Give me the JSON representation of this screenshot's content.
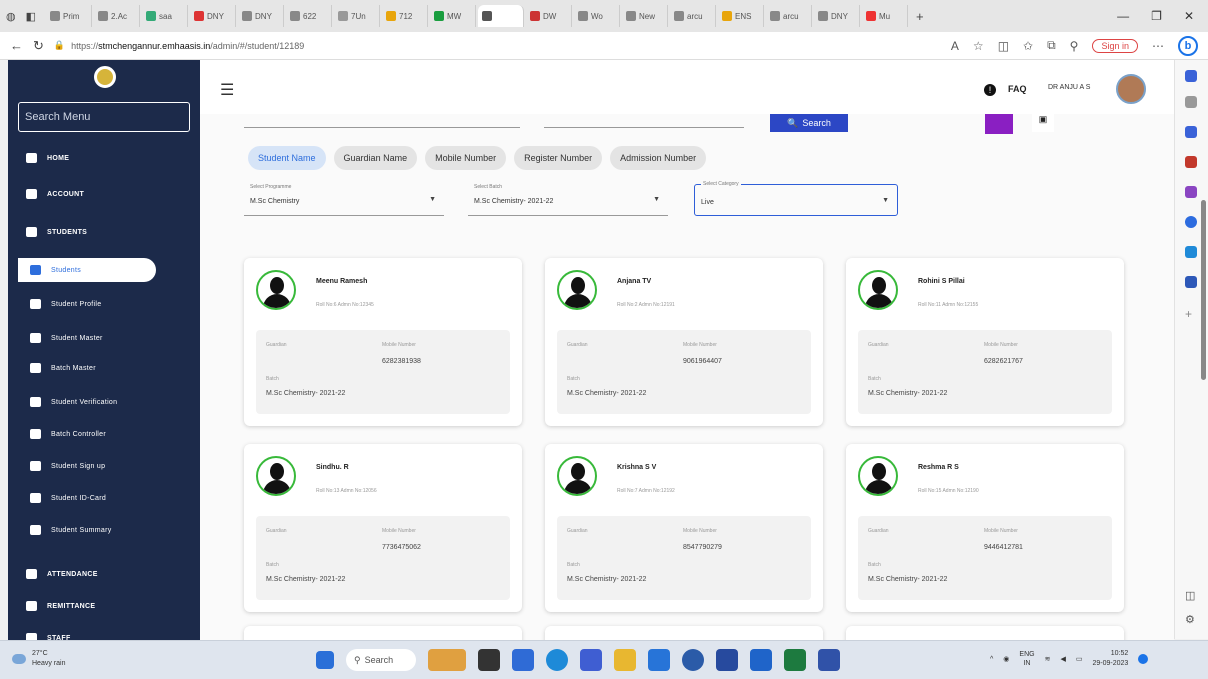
{
  "browser": {
    "tabs": [
      "Prim",
      "2.Ac",
      "saa",
      "DNY",
      "DNY",
      "622",
      "7Un",
      "712",
      "MW",
      "",
      "DW",
      "Wo",
      "New",
      "arcu",
      "ENS",
      "arcu",
      "DNY",
      "Mu"
    ],
    "tab_colors": [
      "#888",
      "#888",
      "#3a7",
      "#d33",
      "#888",
      "#888",
      "#999",
      "#e8a50c",
      "#1a9e3f",
      "#555",
      "#c33",
      "#888",
      "#888",
      "#888",
      "#e8a50c",
      "#888",
      "#888",
      "#e33"
    ],
    "url_prefix": "https://",
    "url_host": "stmchengannur.emhaasis.in",
    "url_path": "/admin/#/student/12189",
    "signin_label": "Sign in",
    "bing_label": "b"
  },
  "sidebar": {
    "search_placeholder": "Search Menu",
    "items": [
      {
        "label": "HOME",
        "icon": "home-icon",
        "name": "sidebar-item-home"
      },
      {
        "label": "ACCOUNT",
        "icon": "account-icon",
        "name": "sidebar-item-account"
      },
      {
        "label": "STUDENTS",
        "icon": "students-icon",
        "name": "sidebar-item-students"
      },
      {
        "label": "Students",
        "icon": "students-group-icon",
        "name": "sidebar-item-students-list"
      },
      {
        "label": "Student Profile",
        "icon": "profile-icon",
        "name": "sidebar-item-student-profile"
      },
      {
        "label": "Student Master",
        "icon": "gear-icon",
        "name": "sidebar-item-student-master"
      },
      {
        "label": "Batch Master",
        "icon": "gear-icon",
        "name": "sidebar-item-batch-master"
      },
      {
        "label": "Student Verification",
        "icon": "verification-icon",
        "name": "sidebar-item-student-verification"
      },
      {
        "label": "Batch Controller",
        "icon": "gear-icon",
        "name": "sidebar-item-batch-controller"
      },
      {
        "label": "Student Sign up",
        "icon": "signup-icon",
        "name": "sidebar-item-student-signup"
      },
      {
        "label": "Student ID-Card",
        "icon": "id-card-icon",
        "name": "sidebar-item-student-id-card"
      },
      {
        "label": "Student Summary",
        "icon": "summary-icon",
        "name": "sidebar-item-student-summary"
      },
      {
        "label": "ATTENDANCE",
        "icon": "attendance-icon",
        "name": "sidebar-item-attendance"
      },
      {
        "label": "REMITTANCE",
        "icon": "remittance-icon",
        "name": "sidebar-item-remittance"
      },
      {
        "label": "STAFF",
        "icon": "staff-icon",
        "name": "sidebar-item-staff"
      }
    ]
  },
  "header": {
    "menu_icon": "☰",
    "help_icon": "!",
    "faq_label": "FAQ",
    "user_name": "DR ANJU A S"
  },
  "filters": {
    "search_button": "Search",
    "search_icon": "🔍",
    "chips": [
      "Student Name",
      "Guardian Name",
      "Mobile Number",
      "Register Number",
      "Admission Number"
    ],
    "selected_chip": 0,
    "programme_label": "Select Programme",
    "programme_value": "M.Sc Chemistry",
    "batch_label": "Select Batch",
    "batch_value": "M.Sc Chemistry- 2021-22",
    "status_label": "Select Category",
    "status_value": "Live"
  },
  "card_labels": {
    "guardian": "Guardian",
    "mobile": "Mobile Number",
    "batch": "Batch"
  },
  "students": [
    {
      "name": "Meenu Ramesh",
      "meta": "Roll No:6   Admn No:12345",
      "mobile": "6282381938",
      "batch": "M.Sc Chemistry- 2021-22"
    },
    {
      "name": "Anjana TV",
      "meta": "Roll No:2   Admn No:12191",
      "mobile": "9061964407",
      "batch": "M.Sc Chemistry- 2021-22"
    },
    {
      "name": "Rohini S Pillai",
      "meta": "Roll No:11   Admn No:12155",
      "mobile": "6282621767",
      "batch": "M.Sc Chemistry- 2021-22"
    },
    {
      "name": "Sindhu. R",
      "meta": "Roll No:13   Admn No:12056",
      "mobile": "7736475062",
      "batch": "M.Sc Chemistry- 2021-22"
    },
    {
      "name": "Krishna S V",
      "meta": "Roll No:7   Admn No:12192",
      "mobile": "8547790279",
      "batch": "M.Sc Chemistry- 2021-22"
    },
    {
      "name": "Reshma R S",
      "meta": "Roll No:15   Admn No:12190",
      "mobile": "9446412781",
      "batch": "M.Sc Chemistry- 2021-22"
    }
  ],
  "taskbar": {
    "temp": "27°C",
    "weather": "Heavy rain",
    "search_label": "Search",
    "lang": "ENG",
    "region": "IN",
    "time": "10:52",
    "date": "29-09-2023"
  }
}
